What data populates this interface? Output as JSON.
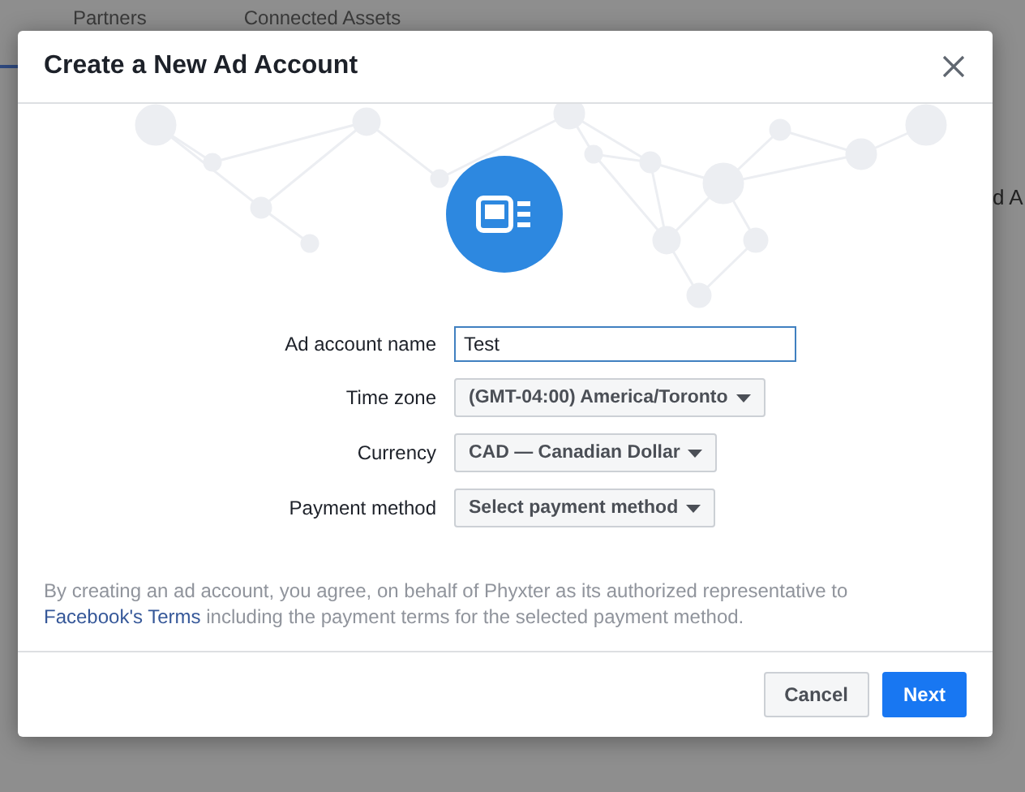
{
  "background": {
    "tabs": [
      {
        "label": "Partners"
      },
      {
        "label": "Connected Assets"
      }
    ],
    "side_text": "d A"
  },
  "dialog": {
    "title": "Create a New Ad Account",
    "fields": [
      {
        "kind": "text",
        "label": "Ad account name",
        "value": "Test"
      },
      {
        "kind": "select",
        "label": "Time zone",
        "value": "(GMT-04:00) America/Toronto"
      },
      {
        "kind": "select",
        "label": "Currency",
        "value": "CAD — Canadian Dollar"
      },
      {
        "kind": "select",
        "label": "Payment method",
        "value": "Select payment method"
      }
    ],
    "disclaimer": {
      "text": "By creating an ad account, you agree, on behalf of Phyxter as its authorized representative to",
      "link": "Facebook's Terms",
      "rest": "including the payment terms for the selected payment method."
    },
    "buttons": [
      {
        "kind": "secondary",
        "label": "Cancel"
      },
      {
        "kind": "primary",
        "label": "Next"
      }
    ]
  }
}
